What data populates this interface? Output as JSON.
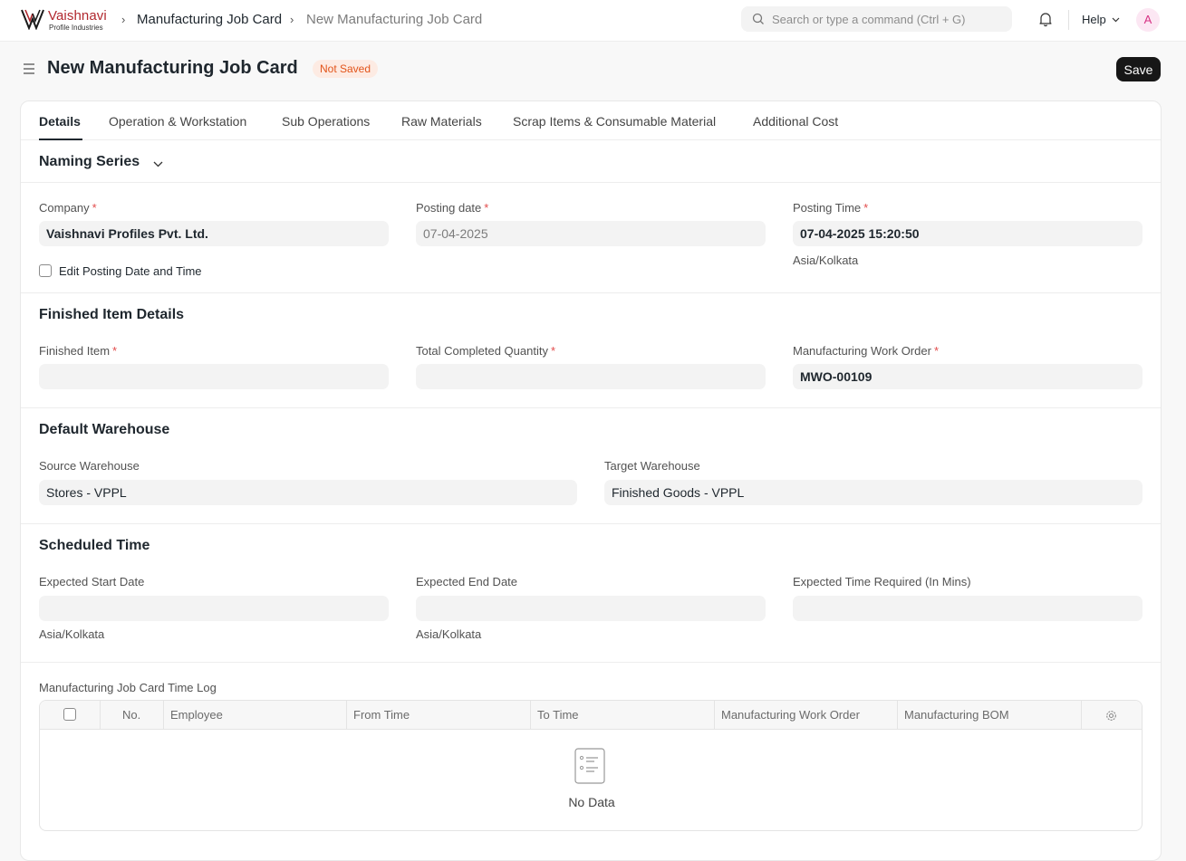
{
  "navbar": {
    "brand_name": "Vaishnavi",
    "brand_sub": "Profile Industries",
    "breadcrumbs": [
      "Manufacturing Job Card",
      "New Manufacturing Job Card"
    ],
    "search_placeholder": "Search or type a command (Ctrl + G)",
    "help_label": "Help",
    "avatar_initial": "A"
  },
  "page": {
    "title": "New Manufacturing Job Card",
    "status": "Not Saved",
    "save_label": "Save"
  },
  "tabs": [
    {
      "label": "Details",
      "active": true
    },
    {
      "label": "Operation & Workstation"
    },
    {
      "label": "Sub Operations"
    },
    {
      "label": "Raw Materials"
    },
    {
      "label": "Scrap Items & Consumable Material"
    },
    {
      "label": "Additional Cost"
    }
  ],
  "naming_series": {
    "title": "Naming Series"
  },
  "general": {
    "company_label": "Company",
    "company_value": "Vaishnavi Profiles Pvt. Ltd.",
    "posting_date_label": "Posting date",
    "posting_date_value": "07-04-2025",
    "posting_time_label": "Posting Time",
    "posting_time_value": "07-04-2025 15:20:50",
    "posting_time_tz": "Asia/Kolkata",
    "edit_posting_label": "Edit Posting Date and Time"
  },
  "finished_item": {
    "title": "Finished Item Details",
    "finished_item_label": "Finished Item",
    "finished_item_value": "",
    "total_qty_label": "Total Completed Quantity",
    "total_qty_value": "",
    "work_order_label": "Manufacturing Work Order",
    "work_order_value": "MWO-00109"
  },
  "warehouse": {
    "title": "Default Warehouse",
    "source_label": "Source Warehouse",
    "source_value": "Stores - VPPL",
    "target_label": "Target Warehouse",
    "target_value": "Finished Goods - VPPL"
  },
  "schedule": {
    "title": "Scheduled Time",
    "start_label": "Expected Start Date",
    "start_tz": "Asia/Kolkata",
    "end_label": "Expected End Date",
    "end_tz": "Asia/Kolkata",
    "time_required_label": "Expected Time Required (In Mins)"
  },
  "time_log": {
    "title": "Manufacturing Job Card Time Log",
    "columns": [
      "No.",
      "Employee",
      "From Time",
      "To Time",
      "Manufacturing Work Order",
      "Manufacturing BOM"
    ],
    "empty_text": "No Data"
  },
  "colors": {
    "brand": "#b1282e",
    "status_bg": "#fdebe3",
    "status_fg": "#e2541a",
    "primary_button": "#171717"
  }
}
